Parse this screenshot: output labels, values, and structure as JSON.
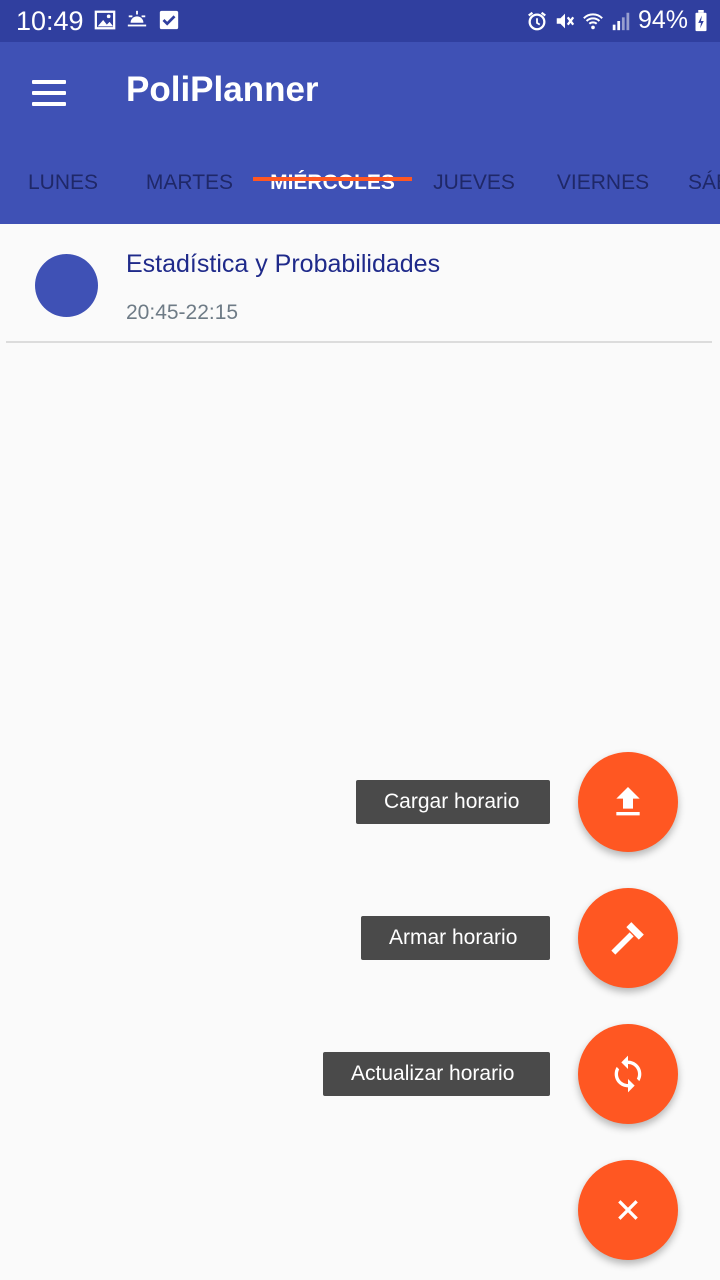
{
  "status_bar": {
    "time": "10:49",
    "battery": "94%",
    "left_icons": [
      "image-icon",
      "weather-icon",
      "checkbox-icon"
    ],
    "right_icons": [
      "alarm-icon",
      "mute-icon",
      "wifi-icon",
      "signal-icon",
      "battery-charging-icon"
    ]
  },
  "app_bar": {
    "title": "PoliPlanner",
    "menu_icon": "hamburger-menu-icon",
    "background": "#3f51b5",
    "status_background": "#303f9f"
  },
  "tabs": [
    {
      "label": "LUNES",
      "active": false
    },
    {
      "label": "MARTES",
      "active": false
    },
    {
      "label": "MIÉRCOLES",
      "active": true
    },
    {
      "label": "JUEVES",
      "active": false
    },
    {
      "label": "VIERNES",
      "active": false
    },
    {
      "label": "SÁBADO",
      "active": false
    }
  ],
  "tab_indicator_color": "#ff5722",
  "schedule": [
    {
      "title": "Estadística y Probabilidades",
      "time": "20:45-22:15",
      "avatar_color": "#3f51b5"
    }
  ],
  "fab_menu": {
    "accent": "#ff5722",
    "actions": [
      {
        "label": "Cargar horario",
        "icon": "upload-icon"
      },
      {
        "label": "Armar horario",
        "icon": "hammer-icon"
      },
      {
        "label": "Actualizar horario",
        "icon": "refresh-icon"
      }
    ],
    "close_icon": "close-icon"
  }
}
